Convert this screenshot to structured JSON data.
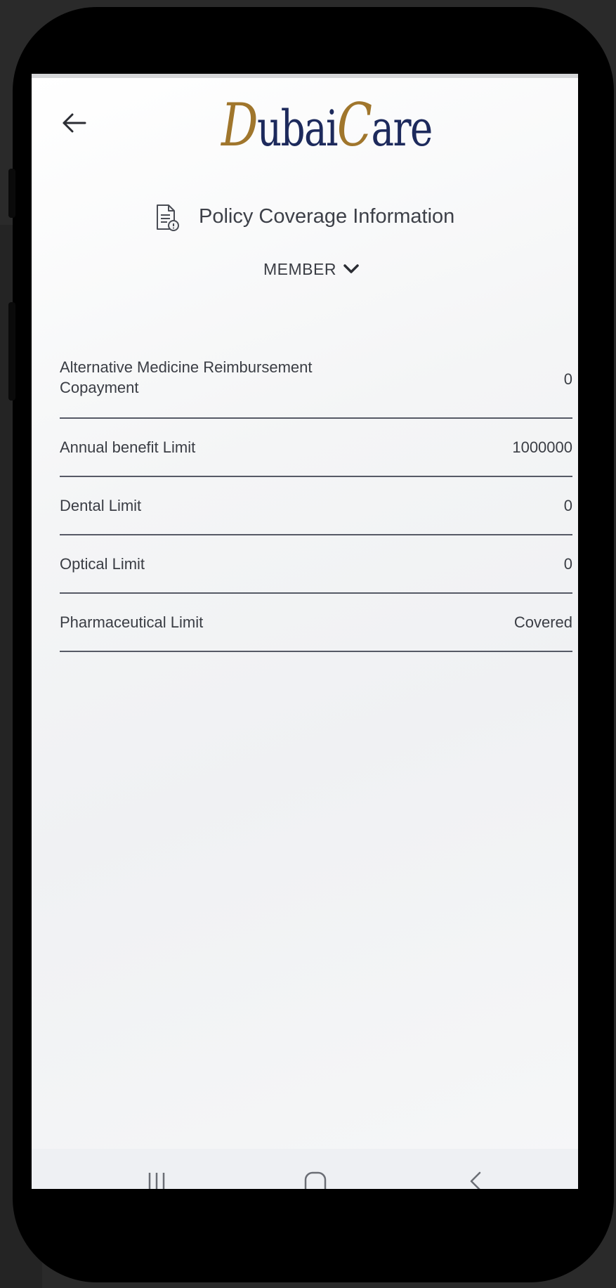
{
  "header": {
    "back_icon": "arrow-left-icon",
    "logo_text_part1": "D",
    "logo_text_part2": "ubai",
    "logo_text_part3": "C",
    "logo_text_part4": "are"
  },
  "title": {
    "icon": "document-info-icon",
    "text": "Policy Coverage Information"
  },
  "member_dropdown": {
    "label": "MEMBER",
    "icon": "chevron-down-icon"
  },
  "coverage_items": [
    {
      "label": "Alternative Medicine Reimbursement Copayment",
      "value": "0"
    },
    {
      "label": "Annual benefit Limit",
      "value": "1000000"
    },
    {
      "label": "Dental Limit",
      "value": "0"
    },
    {
      "label": "Optical Limit",
      "value": "0"
    },
    {
      "label": "Pharmaceutical Limit",
      "value": "Covered"
    }
  ],
  "navbar": {
    "recent_icon": "recent-apps-icon",
    "home_icon": "home-icon",
    "back_icon": "back-chevron-icon"
  },
  "colors": {
    "logo_navy": "#1d2a5c",
    "logo_gold": "#a0762c",
    "divider": "#565a66",
    "text": "#3a3d44"
  }
}
